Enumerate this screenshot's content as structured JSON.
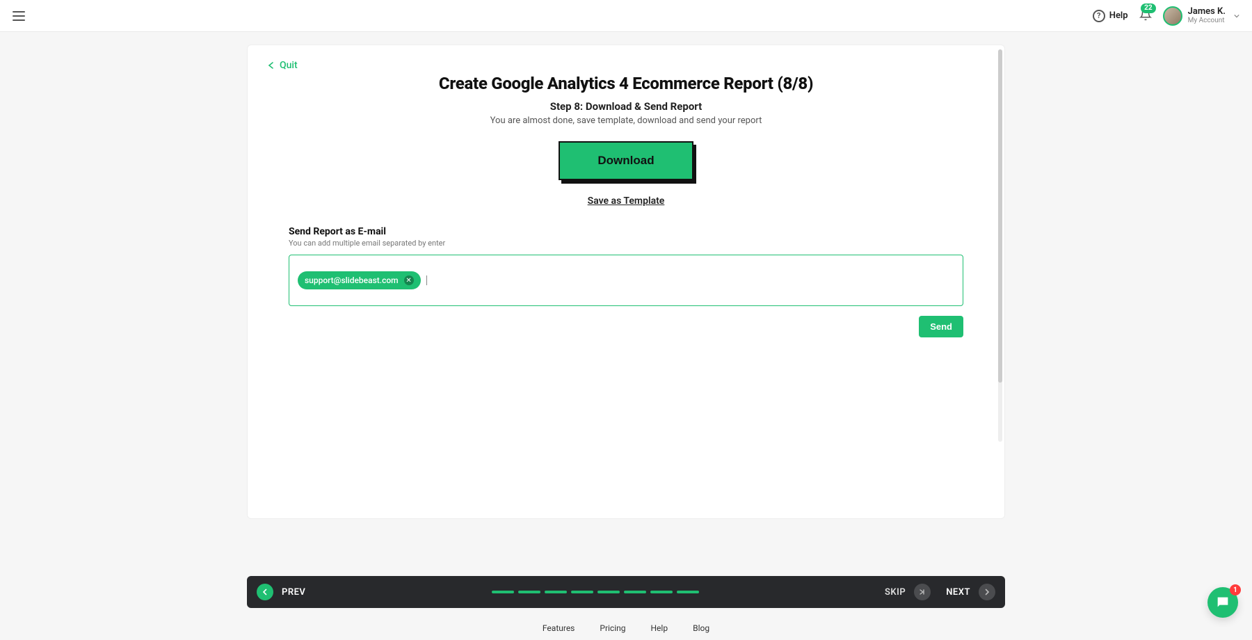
{
  "header": {
    "help_label": "Help",
    "notification_count": "22",
    "user_name": "James K.",
    "user_subtitle": "My Account"
  },
  "card": {
    "quit_label": "Quit",
    "title": "Create Google Analytics 4 Ecommerce Report (8/8)",
    "step_title": "Step 8: Download & Send Report",
    "step_desc": "You are almost done, save template, download and send your report",
    "download_label": "Download",
    "save_template_label": "Save as Template",
    "email_label": "Send Report as E-mail",
    "email_help": "You can add multiple email separated by enter",
    "email_chips": [
      "support@slidebeast.com"
    ],
    "send_label": "Send"
  },
  "wiznav": {
    "prev_label": "PREV",
    "skip_label": "SKIP",
    "next_label": "NEXT",
    "segments": 8
  },
  "footer": {
    "links": [
      "Features",
      "Pricing",
      "Help",
      "Blog"
    ]
  },
  "chat": {
    "badge": "1"
  }
}
